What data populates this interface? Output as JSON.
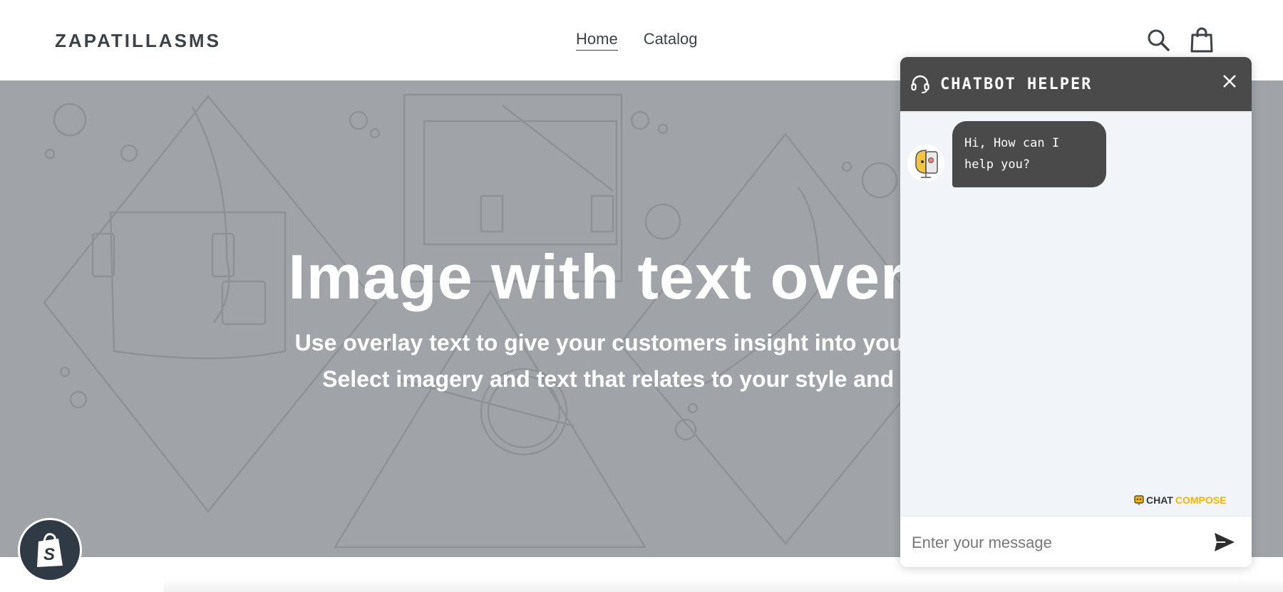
{
  "header": {
    "logo": "ZAPATILLASMS",
    "nav": [
      {
        "label": "Home",
        "active": true
      },
      {
        "label": "Catalog",
        "active": false
      }
    ],
    "icons": [
      "search-icon",
      "cart-icon"
    ]
  },
  "hero": {
    "title": "Image with text overlay",
    "subtitle_line1": "Use overlay text to give your customers insight into your brand.",
    "subtitle_line2": "Select imagery and text that relates to your style and story."
  },
  "chatbot": {
    "title": "CHATBOT HELPER",
    "messages": [
      {
        "from": "bot",
        "line1": "Hi, How can I",
        "line2": "help you?"
      }
    ],
    "branding_part1": "CHAT",
    "branding_part2": "COMPOSE",
    "input_placeholder": "Enter your message"
  },
  "colors": {
    "hero_bg": "#a0a4a8",
    "chat_header": "#4a4a4a",
    "chat_body": "#f1f5f9",
    "brand_accent": "#f4b400"
  }
}
